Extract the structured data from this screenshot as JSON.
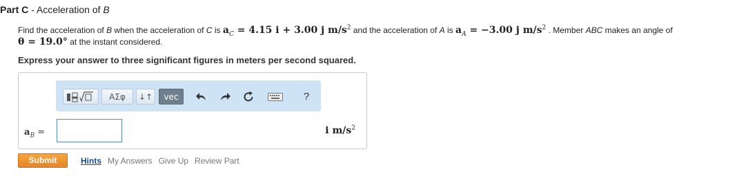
{
  "part": {
    "prefix": "Part C",
    "separator": " - ",
    "title_text": "Acceleration of ",
    "title_var": "B"
  },
  "question": {
    "t1": "Find the acceleration of ",
    "var_b": "B",
    "t2": " when the acceleration of ",
    "var_c": "C",
    "t3": " is ",
    "ac_symbol": "a",
    "ac_sub": "C",
    "ac_value": " = 4.15 i + 3.00 j m/s",
    "ac_exp": "2",
    "t4": " and the acceleration of ",
    "var_a": "A",
    "t5": " is ",
    "aa_symbol": "a",
    "aa_sub": "A",
    "aa_value": " = −3.00 j m/s",
    "aa_exp": "2",
    "t6": " . Member ",
    "member": "ABC",
    "t7": " makes an angle of",
    "theta": "θ = 19.0°",
    "t8": " at the instant considered."
  },
  "instruction": "Express your answer to three significant figures in meters per second squared.",
  "toolbar": {
    "greek_label": "ΑΣφ",
    "arrows_label": "↓↑",
    "vec_label": "vec",
    "help_label": "?"
  },
  "answer": {
    "symbol": "a",
    "sub": "B",
    "equals": " =",
    "value": "",
    "unit": "i m/s",
    "unit_exp": "2"
  },
  "actions": {
    "submit": "Submit",
    "hints": "Hints",
    "my_answers": "My Answers",
    "give_up": "Give Up",
    "review_part": "Review Part"
  },
  "colors": {
    "toolbar_bg": "#cfe3f7",
    "submit": "#f39a35",
    "link": "#1a4b8c"
  }
}
